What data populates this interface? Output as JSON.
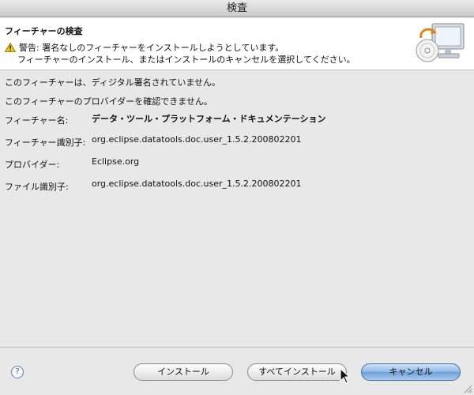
{
  "window": {
    "title": "検査"
  },
  "header": {
    "title": "フィーチャーの検査",
    "warning_line1": "警告: 署名なしのフィーチャーをインストールしようとしています。",
    "warning_line2": "フィーチャーのインストール、またはインストールのキャンセルを選択してください。"
  },
  "messages": [
    "このフィーチャーは、ディジタル署名されていません。",
    "このフィーチャーのプロバイダーを確認できません。"
  ],
  "details": [
    {
      "label": "フィーチャー名:",
      "value": "データ・ツール・プラットフォーム・ドキュメンテーション"
    },
    {
      "label": "フィーチャー識別子:",
      "value": "org.eclipse.datatools.doc.user_1.5.2.200802201"
    },
    {
      "label": "プロバイダー:",
      "value": "Eclipse.org"
    },
    {
      "label": "ファイル識別子:",
      "value": "org.eclipse.datatools.doc.user_1.5.2.200802201"
    }
  ],
  "buttons": {
    "help": "?",
    "install": "インストール",
    "install_all": "すべてインストール",
    "cancel": "キャンセル"
  },
  "icons": {
    "warning": "warning-triangle-icon",
    "header": "computer-install-icon",
    "cursor": "mouse-pointer-icon"
  }
}
